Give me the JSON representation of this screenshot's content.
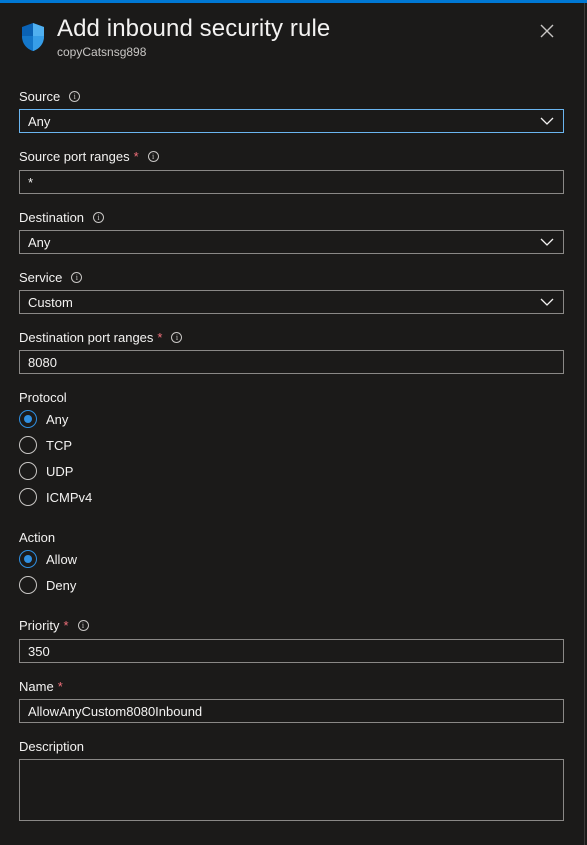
{
  "header": {
    "title": "Add inbound security rule",
    "subtitle": "copyCatsnsg898"
  },
  "source": {
    "label": "Source",
    "value": "Any"
  },
  "source_port_ranges": {
    "label": "Source port ranges",
    "required_mark": "*",
    "value": "*"
  },
  "destination": {
    "label": "Destination",
    "value": "Any"
  },
  "service": {
    "label": "Service",
    "value": "Custom"
  },
  "destination_port_ranges": {
    "label": "Destination port ranges",
    "required_mark": "*",
    "value": "8080"
  },
  "protocol": {
    "label": "Protocol",
    "options": [
      "Any",
      "TCP",
      "UDP",
      "ICMPv4"
    ],
    "selected": "Any"
  },
  "action": {
    "label": "Action",
    "options": [
      "Allow",
      "Deny"
    ],
    "selected": "Allow"
  },
  "priority": {
    "label": "Priority",
    "required_mark": "*",
    "value": "350"
  },
  "name": {
    "label": "Name",
    "required_mark": "*",
    "value": "AllowAnyCustom8080Inbound"
  },
  "description": {
    "label": "Description",
    "value": ""
  },
  "icons": {
    "header": "shield-icon",
    "close": "close-icon",
    "info": "info-icon",
    "dropdown": "chevron-down-icon"
  },
  "colors": {
    "background": "#1b1a19",
    "accent": "#0078d4",
    "radio_selected": "#2f8fe0",
    "required": "#f1707b",
    "field_border": "#8a8886",
    "focus_border": "#6bb5f0"
  }
}
